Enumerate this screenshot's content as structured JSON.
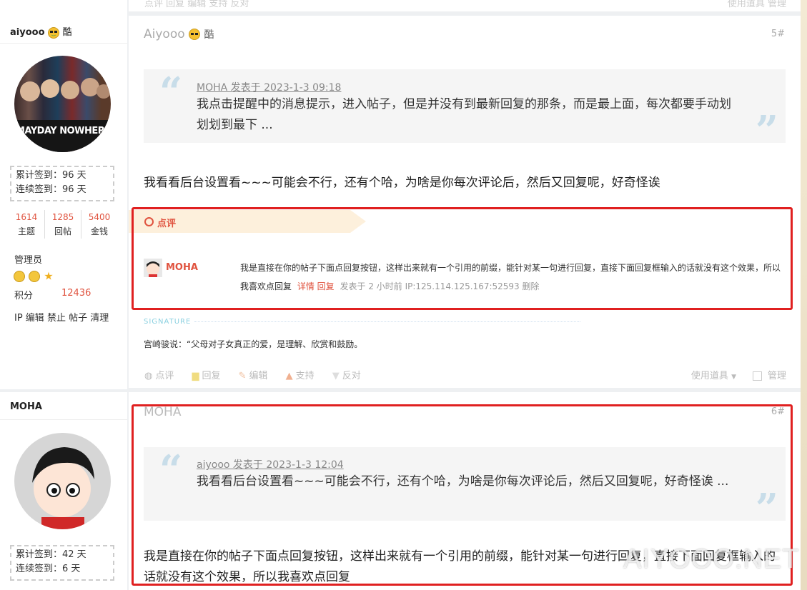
{
  "top_toolbar": {
    "left": "点评 回复 编辑 支持 反对",
    "right": "使用道具 管理"
  },
  "user1": {
    "name": "aiyooo",
    "tag": "酷",
    "checkin_total": "累计签到：96 天",
    "checkin_streak": "连续签到：96 天",
    "stats": [
      {
        "value": "1614",
        "label": "主题"
      },
      {
        "value": "1285",
        "label": "回帖"
      },
      {
        "value": "5400",
        "label": "金钱"
      }
    ],
    "group": "管理员",
    "points_label": "积分",
    "points_value": "12436",
    "admin_links": "IP 编辑 禁止 帖子 清理",
    "avatar_text": "MAYDAY NOWHERE"
  },
  "post5": {
    "author": "Aiyooo",
    "tag": "酷",
    "floor": "5#",
    "quote_head": "MOHA 发表于 2023-1-3 09:18",
    "quote_text": "我点击提醒中的消息提示，进入帖子，但是并没有到最新回复的那条，而是最上面，每次都要手动划划划到最下 ...",
    "body": "我看看后台设置看~~~可能会不行，还有个哈，为啥是你每次评论后，然后又回复呢，好奇怪诶",
    "comment_section_title": "点评",
    "comment": {
      "author": "MOHA",
      "text": "我是直接在你的帖子下面点回复按钮，这样出来就有一个引用的前缀，能针对某一句进行回复，直接下面回复框输入的话就没有这个效果，所以我喜欢点回复",
      "links": "详情 回复",
      "meta": "发表于 2 小时前 IP:125.114.125.167:52593 删除"
    },
    "signature_label": "SIGNATURE",
    "signature": "宫崎骏说：“父母对子女真正的爱，是理解、欣赏和鼓励。",
    "actions": [
      "点评",
      "回复",
      "编辑",
      "支持",
      "反对"
    ],
    "tools": "使用道具",
    "manage": "管理"
  },
  "user2": {
    "name": "MOHA",
    "checkin_total": "累计签到：42 天",
    "checkin_streak": "连续签到：6 天"
  },
  "post6": {
    "author": "MOHA",
    "floor": "6#",
    "quote_head": "aiyooo 发表于 2023-1-3 12:04",
    "quote_text": "我看看后台设置看~~~可能会不行，还有个哈，为啥是你每次评论后，然后又回复呢，好奇怪诶 ...",
    "body": "我是直接在你的帖子下面点回复按钮，这样出来就有一个引用的前缀，能针对某一句进行回复，直接下面回复框输入的话就没有这个效果，所以我喜欢点回复"
  },
  "watermark": "AIYOOO.NET"
}
